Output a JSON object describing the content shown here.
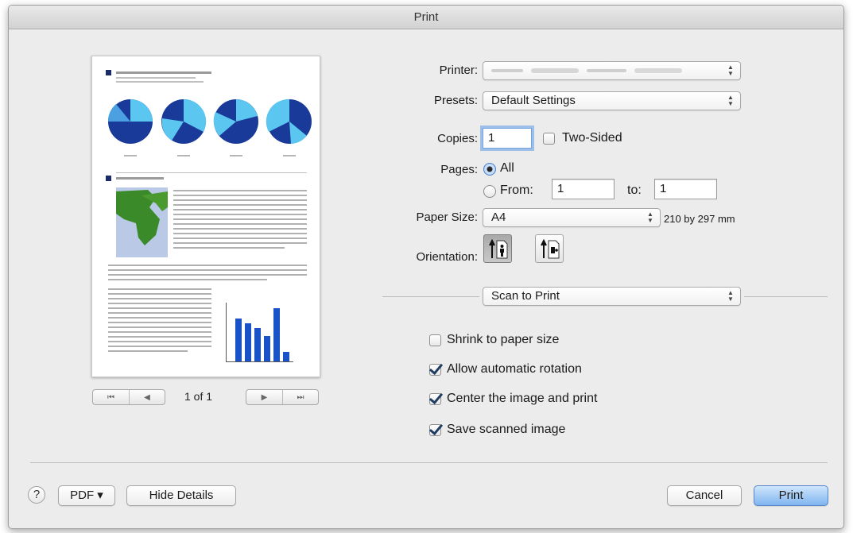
{
  "window": {
    "title": "Print"
  },
  "preview": {
    "page_counter": "1 of 1",
    "nav_first_icon": "⏮",
    "nav_prev_icon": "◀",
    "nav_next_icon": "▶",
    "nav_last_icon": "⏭"
  },
  "printer": {
    "label": "Printer:",
    "value": ""
  },
  "presets": {
    "label": "Presets:",
    "value": "Default Settings"
  },
  "copies": {
    "label": "Copies:",
    "value": "1",
    "two_sided_label": "Two-Sided",
    "two_sided_checked": false
  },
  "pages": {
    "label": "Pages:",
    "all_label": "All",
    "from_label": "From:",
    "from_value": "1",
    "to_label": "to:",
    "to_value": "1",
    "selected": "all"
  },
  "paper_size": {
    "label": "Paper Size:",
    "value": "A4",
    "dimensions": "210 by 297 mm"
  },
  "orientation": {
    "label": "Orientation:",
    "selected": "portrait"
  },
  "section_popup": {
    "value": "Scan to Print"
  },
  "options": [
    {
      "label": "Shrink to paper size",
      "checked": false
    },
    {
      "label": "Allow automatic rotation",
      "checked": true
    },
    {
      "label": "Center the image and print",
      "checked": true
    },
    {
      "label": "Save scanned image",
      "checked": true
    }
  ],
  "footer": {
    "help_label": "?",
    "pdf_label": "PDF ▾",
    "hide_details_label": "Hide Details",
    "cancel_label": "Cancel",
    "print_label": "Print"
  },
  "colors": {
    "accent": "#7fb4ef",
    "chart_dark": "#1a3a9a",
    "chart_light": "#5bc6f0",
    "map_green": "#3a8a2a"
  }
}
